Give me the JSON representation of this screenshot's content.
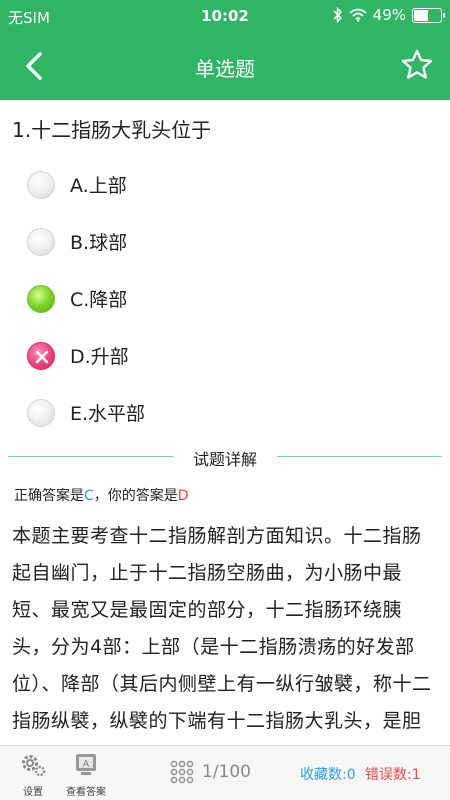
{
  "status_bar": {
    "carrier": "无SIM",
    "time": "10:02",
    "battery": "49%",
    "battery_level": 0.49
  },
  "nav": {
    "title": "单选题",
    "back_icon": "chevron-left-icon",
    "star_icon": "star-outline-icon"
  },
  "question": {
    "text": "1.十二指肠大乳头位于",
    "options": [
      {
        "label": "A.上部",
        "state": "none"
      },
      {
        "label": "B.球部",
        "state": "none"
      },
      {
        "label": "C.降部",
        "state": "correct"
      },
      {
        "label": "D.升部",
        "state": "wrong"
      },
      {
        "label": "E.水平部",
        "state": "none"
      }
    ]
  },
  "detail": {
    "section_title": "试题详解",
    "correct_prefix": "正确答案是",
    "correct_answer": "C",
    "user_prefix": "，你的答案是",
    "user_answer": "D",
    "explanation": "本题主要考查十二指肠解剖方面知识。十二指肠起自幽门，止于十二指肠空肠曲，为小肠中最短、最宽又是最固定的部分，十二指肠环绕胰头，分为4部：上部（是十二指肠溃疡的好发部位）、降部（其后内侧壁上有一纵行皱襞，称十二指肠纵襞，纵襞的下端有十二指肠大乳头，是胆管和胰管的共同开口）"
  },
  "bottom_bar": {
    "settings_label": "设置",
    "view_answer_label": "查看答案",
    "progress": "1/100",
    "favorites": "收藏数:0",
    "errors": "错误数:1"
  },
  "colors": {
    "brand": "#2fb564",
    "correct": "#2aa0e0",
    "wrong": "#e84a4a"
  }
}
